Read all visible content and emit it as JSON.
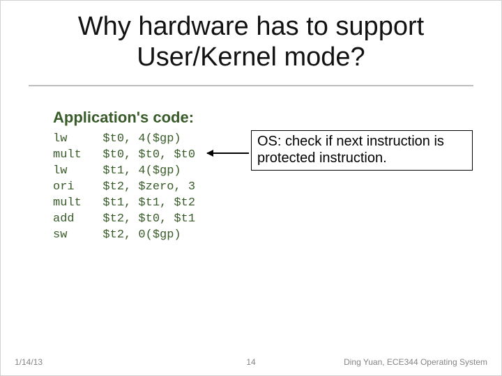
{
  "title": "Why hardware has to support User/Kernel mode?",
  "section_label": "Application's code:",
  "code": "lw     $t0, 4($gp)\nmult   $t0, $t0, $t0\nlw     $t1, 4($gp)\nori    $t2, $zero, 3\nmult   $t1, $t1, $t2\nadd    $t2, $t0, $t1\nsw     $t2, 0($gp)",
  "callout": "OS: check if next instruction is protected instruction.",
  "footer": {
    "date": "1/14/13",
    "page": "14",
    "attribution": "Ding Yuan, ECE344 Operating System"
  }
}
